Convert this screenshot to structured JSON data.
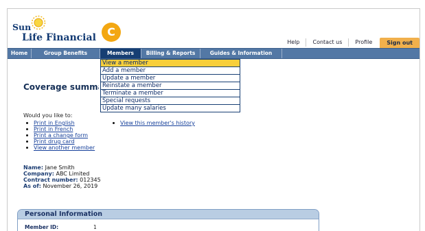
{
  "logo": {
    "line1": "Sun",
    "line2": "Life Financial"
  },
  "badge": {
    "letter": "C"
  },
  "util": {
    "help": "Help",
    "contact": "Contact us",
    "profile": "Profile",
    "signout": "Sign out"
  },
  "nav": [
    "Home",
    "Group Benefits",
    "Members",
    "Billing & Reports",
    "Guides & Information"
  ],
  "dropdown": [
    "View a member",
    "Add a member",
    "Update a member",
    "Reinstate a member",
    "Terminate a member",
    "Special requests",
    "Update many salaries"
  ],
  "page": {
    "title": "Coverage summary",
    "would_you_like": "Would you like to:",
    "links_left": [
      "Print in English",
      "Print in French",
      "Print a change form",
      "Print drug card",
      "View another member"
    ],
    "links_right": [
      "View this member's history"
    ]
  },
  "member": {
    "name_label": "Name:",
    "name": "Jane Smith",
    "company_label": "Company:",
    "company": "ABC Limited",
    "contract_label": "Contract number:",
    "contract": "012345",
    "asof_label": "As of:",
    "asof": "November 26, 2019"
  },
  "panel": {
    "title": "Personal Information",
    "member_id_label": "Member ID:",
    "member_id": "1"
  },
  "colors": {
    "nav": "#5378a5",
    "nav_active": "#163e73",
    "accent": "#f3a712",
    "dropdown_active": "#f8cf3b"
  }
}
